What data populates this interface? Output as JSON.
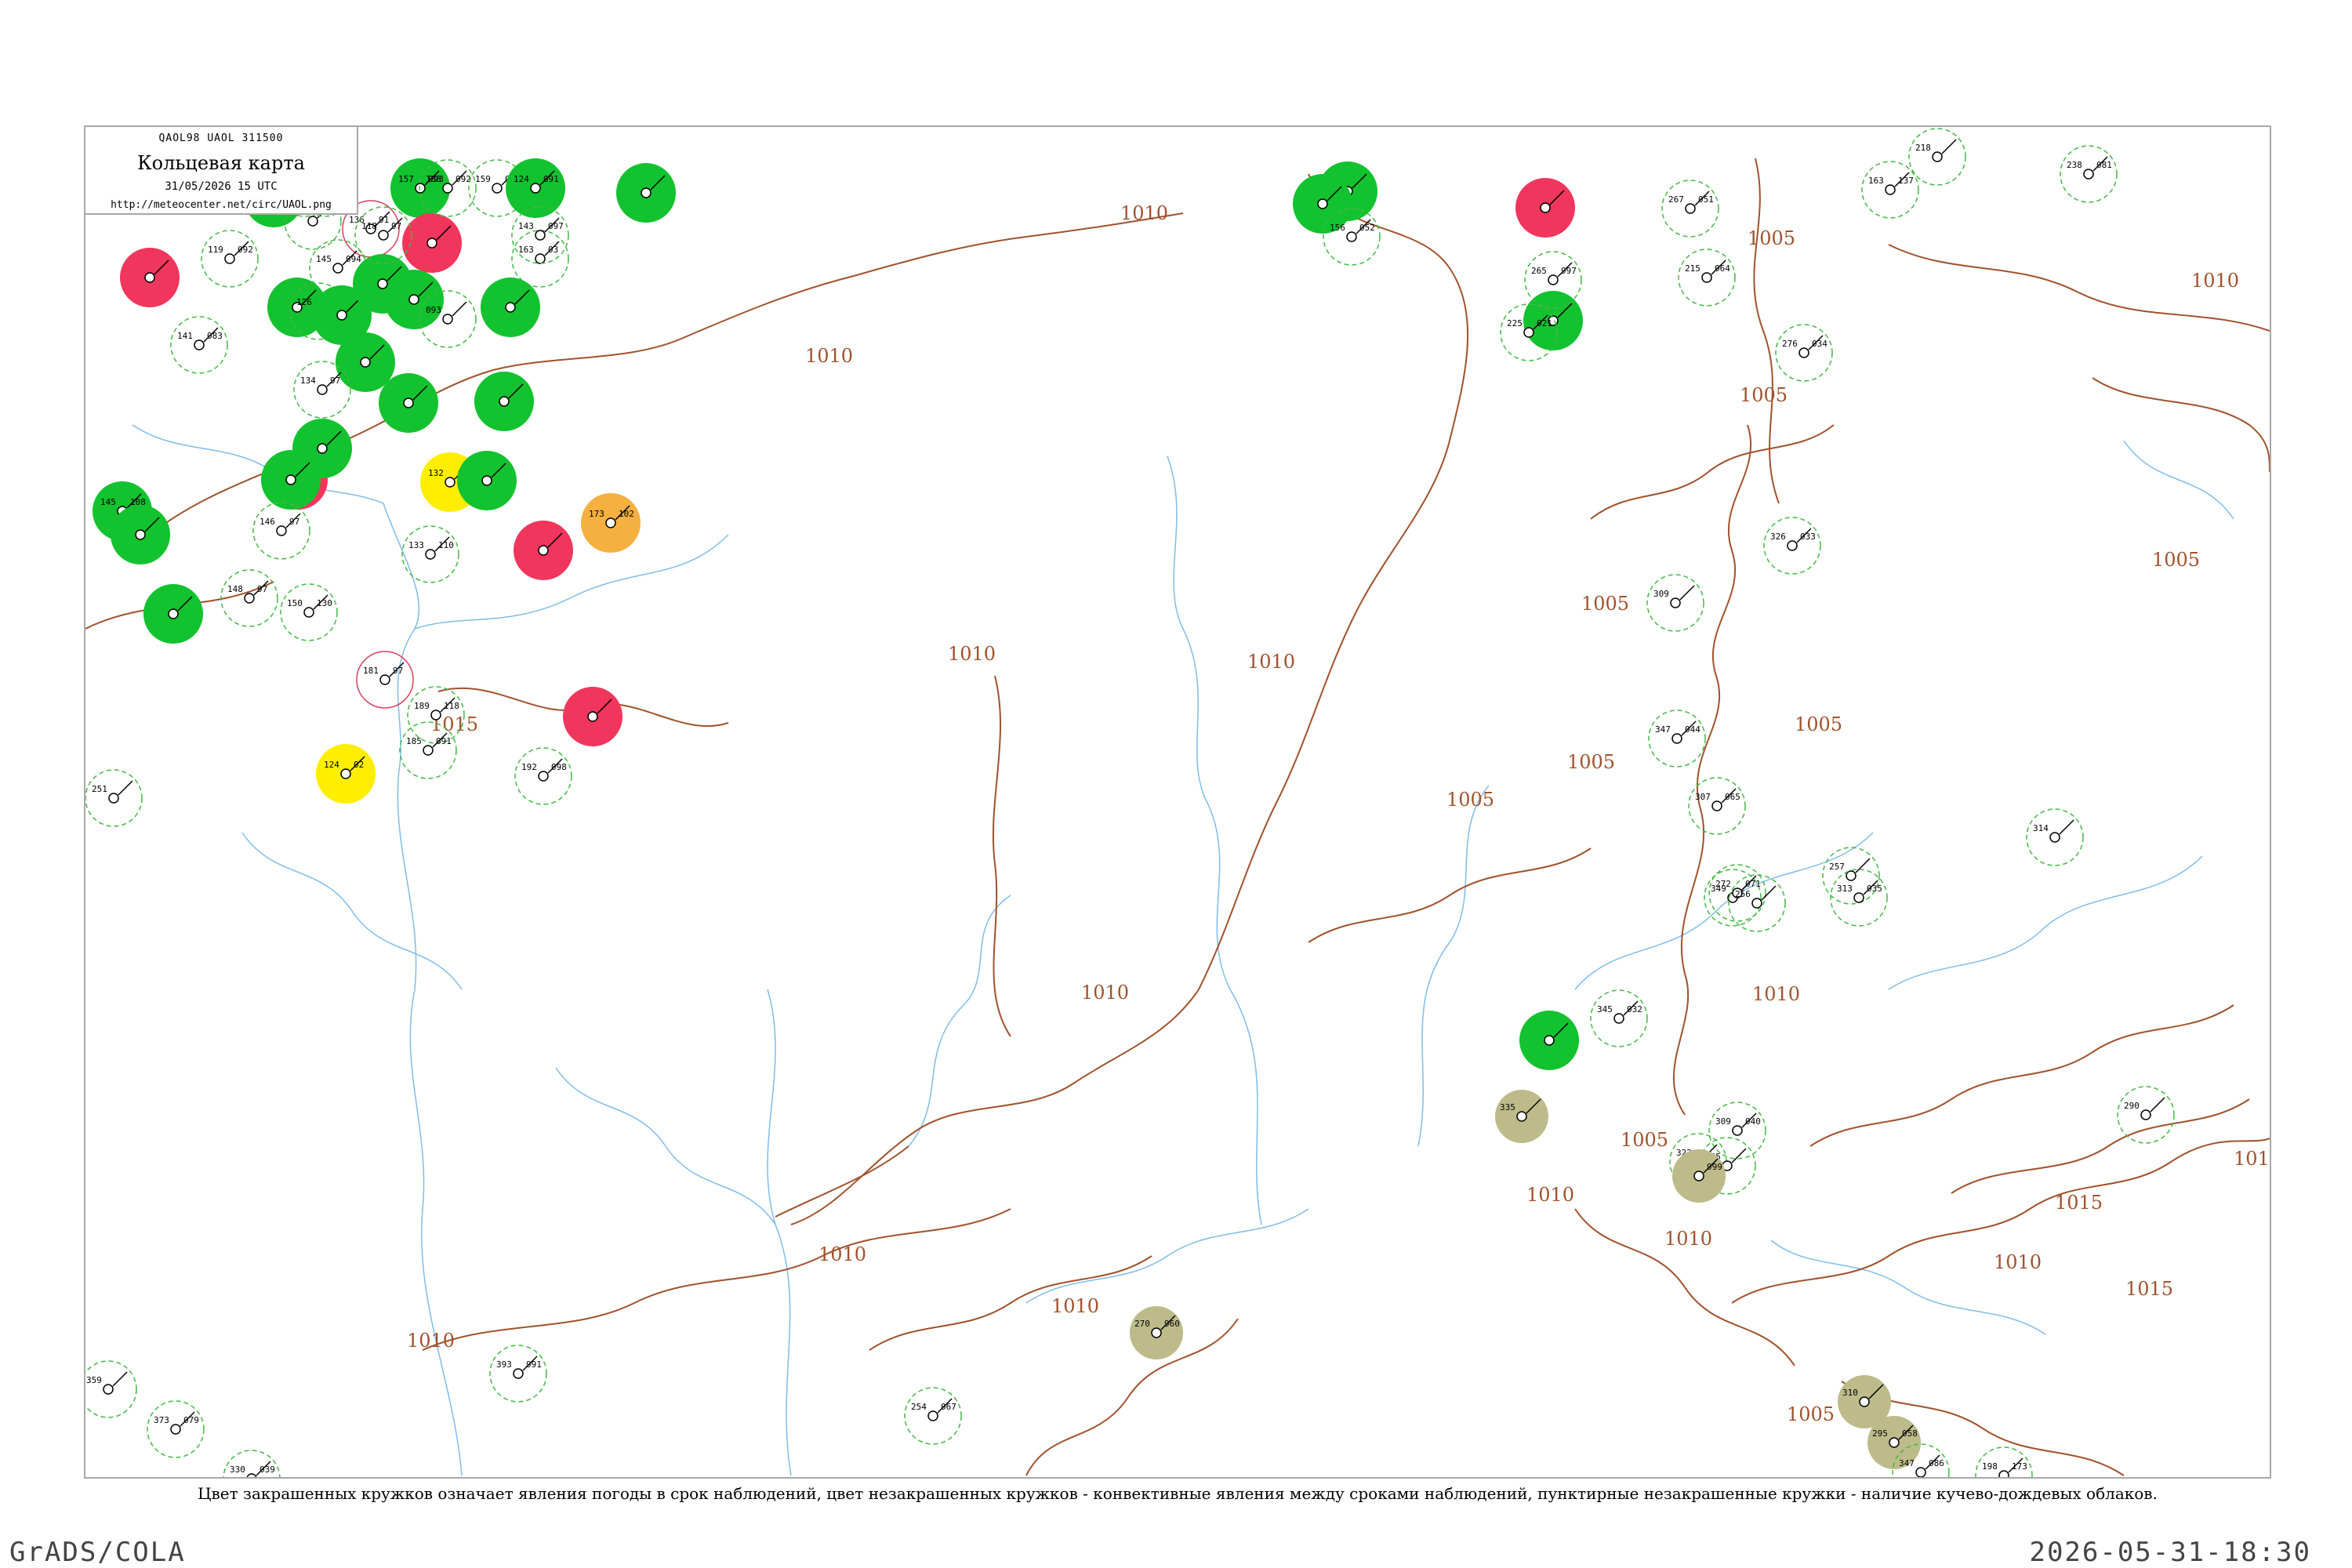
{
  "header": {
    "code": "QAOL98 UAOL 311500",
    "title": "Кольцевая карта",
    "date": "31/05/2026 15 UTC",
    "url": "http://meteocenter.net/circ/UAOL.png"
  },
  "legend_caption": "Цвет закрашенных кружков означает явления погоды в срок наблюдений, цвет незакрашенных кружков - конвективные явления между сроками наблюдений, пунктирные незакрашенные кружки - наличие кучево-дождевых облаков.",
  "footer": {
    "left": "GrADS/COLA",
    "right": "2026-05-31-18:30"
  },
  "colors": {
    "green_fill": "#12c22e",
    "red_fill": "#f0365c",
    "yellow_fill": "#ffee00",
    "orange_fill": "#f5b040",
    "olive_fill": "#bdbb8a",
    "green_ring": "#44b844",
    "red_ring": "#d84060",
    "isobar": "#a0522d",
    "river": "#80bce8"
  },
  "isobar_labels": [
    "1010",
    "1015",
    "1005",
    "101"
  ],
  "stations": [
    {
      "fill": "red",
      "p": "",
      "t": "",
      "n": "",
      "name": ""
    },
    {
      "fill": "green",
      "p": "156",
      "t": "97",
      "n": "",
      "name": ""
    },
    {
      "fill": "none",
      "p": "095",
      "t": "",
      "n": "",
      "name": ""
    },
    {
      "fill": "none",
      "p": "134",
      "t": "97",
      "n": "",
      "name": ""
    },
    {
      "fill": "none",
      "p": "130",
      "t": "97",
      "n": "",
      "name": ""
    },
    {
      "fill": "red-ring",
      "p": "136",
      "t": "91",
      "n": "",
      "name": ""
    },
    {
      "fill": "green",
      "p": "157",
      "t": "093",
      "n": "",
      "name": ""
    },
    {
      "fill": "red",
      "p": "",
      "t": "",
      "n": "",
      "name": ""
    },
    {
      "fill": "none",
      "p": "188",
      "t": "092",
      "n": "",
      "name": ""
    },
    {
      "fill": "none",
      "p": "159",
      "t": "097",
      "n": "",
      "name": ""
    },
    {
      "fill": "green",
      "p": "124",
      "t": "091",
      "n": "",
      "name": ""
    },
    {
      "fill": "green",
      "p": "",
      "t": "",
      "n": "",
      "name": ""
    },
    {
      "fill": "green",
      "p": "",
      "t": "",
      "n": "",
      "name": ""
    },
    {
      "fill": "none",
      "p": "163",
      "t": "03",
      "n": "",
      "name": ""
    },
    {
      "fill": "none",
      "p": "143",
      "t": "097",
      "n": "",
      "name": ""
    },
    {
      "fill": "none",
      "p": "145",
      "t": "094",
      "n": "",
      "name": ""
    },
    {
      "fill": "green",
      "p": "",
      "t": "",
      "n": "",
      "name": ""
    },
    {
      "fill": "green",
      "p": "",
      "t": "",
      "n": "",
      "name": ""
    },
    {
      "fill": "none",
      "p": "119",
      "t": "092",
      "n": "",
      "name": ""
    },
    {
      "fill": "none",
      "p": "126",
      "t": "97",
      "n": "",
      "name": ""
    },
    {
      "fill": "green",
      "p": "",
      "t": "",
      "n": "",
      "name": ""
    },
    {
      "fill": "green",
      "p": "",
      "t": "",
      "n": "",
      "name": ""
    },
    {
      "fill": "none",
      "p": "118",
      "t": "97",
      "n": "",
      "name": ""
    },
    {
      "fill": "green",
      "p": "",
      "t": "",
      "n": "",
      "name": ""
    },
    {
      "fill": "green",
      "p": "",
      "t": "",
      "n": "",
      "name": ""
    },
    {
      "fill": "none",
      "p": "093",
      "t": "",
      "n": "",
      "name": ""
    },
    {
      "fill": "none",
      "p": "141",
      "t": "083",
      "n": "",
      "name": ""
    },
    {
      "fill": "green",
      "p": "",
      "t": "",
      "n": "",
      "name": ""
    },
    {
      "fill": "none",
      "p": "134",
      "t": "97",
      "n": "",
      "name": ""
    },
    {
      "fill": "green",
      "p": "",
      "t": "",
      "n": "",
      "name": ""
    },
    {
      "fill": "red",
      "p": "",
      "t": "",
      "n": "",
      "name": ""
    },
    {
      "fill": "green",
      "p": "",
      "t": "",
      "n": "",
      "name": ""
    },
    {
      "fill": "green",
      "p": "",
      "t": "",
      "n": "",
      "name": ""
    },
    {
      "fill": "yellow",
      "p": "132",
      "t": "96",
      "n": "",
      "name": ""
    },
    {
      "fill": "green",
      "p": "",
      "t": "",
      "n": "",
      "name": ""
    },
    {
      "fill": "orange",
      "p": "173",
      "t": "102",
      "n": "",
      "name": ""
    },
    {
      "fill": "green",
      "p": "145",
      "t": "108",
      "n": "",
      "name": ""
    },
    {
      "fill": "green",
      "p": "",
      "t": "",
      "n": "",
      "name": ""
    },
    {
      "fill": "red",
      "p": "",
      "t": "",
      "n": "",
      "name": ""
    },
    {
      "fill": "none",
      "p": "146",
      "t": "97",
      "n": "",
      "name": ""
    },
    {
      "fill": "none",
      "p": "133",
      "t": "110",
      "n": "",
      "name": ""
    },
    {
      "fill": "green",
      "p": "",
      "t": "",
      "n": "",
      "name": ""
    },
    {
      "fill": "none",
      "p": "148",
      "t": "97",
      "n": "",
      "name": ""
    },
    {
      "fill": "none",
      "p": "150",
      "t": "130",
      "n": "",
      "name": ""
    },
    {
      "fill": "red-ring",
      "p": "181",
      "t": "97",
      "n": "",
      "name": ""
    },
    {
      "fill": "none",
      "p": "189",
      "t": "118",
      "n": "",
      "name": ""
    },
    {
      "fill": "red",
      "p": "",
      "t": "",
      "n": "",
      "name": ""
    },
    {
      "fill": "none",
      "p": "185",
      "t": "091",
      "n": "",
      "name": ""
    },
    {
      "fill": "yellow",
      "p": "124",
      "t": "02",
      "n": "",
      "name": ""
    },
    {
      "fill": "none",
      "p": "192",
      "t": "098",
      "n": "",
      "name": ""
    },
    {
      "fill": "green",
      "p": "",
      "t": "",
      "n": "",
      "name": ""
    },
    {
      "fill": "none",
      "p": "156",
      "t": "052",
      "n": "",
      "name": ""
    },
    {
      "fill": "red",
      "p": "",
      "t": "",
      "n": "",
      "name": ""
    },
    {
      "fill": "green",
      "p": "",
      "t": "",
      "n": "",
      "name": ""
    },
    {
      "fill": "none",
      "p": "265",
      "t": "997",
      "n": "",
      "name": ""
    },
    {
      "fill": "none",
      "p": "225",
      "t": "021",
      "n": "",
      "name": ""
    },
    {
      "fill": "none",
      "p": "267",
      "t": "051",
      "n": "",
      "name": ""
    },
    {
      "fill": "none",
      "p": "215",
      "t": "064",
      "n": "",
      "name": ""
    },
    {
      "fill": "none",
      "p": "276",
      "t": "034",
      "n": "",
      "name": ""
    },
    {
      "fill": "none",
      "p": "326",
      "t": "033",
      "n": "",
      "name": ""
    },
    {
      "fill": "none",
      "p": "309",
      "t": "",
      "n": "",
      "name": ""
    },
    {
      "fill": "none",
      "p": "347",
      "t": "044",
      "n": "",
      "name": ""
    },
    {
      "fill": "none",
      "p": "307",
      "t": "065",
      "n": "",
      "name": ""
    },
    {
      "fill": "none",
      "p": "349",
      "t": "",
      "n": "",
      "name": ""
    },
    {
      "fill": "none",
      "p": "272",
      "t": "071",
      "n": "",
      "name": ""
    },
    {
      "fill": "none",
      "p": "256",
      "t": "",
      "n": "",
      "name": ""
    },
    {
      "fill": "none",
      "p": "257",
      "t": "",
      "n": "",
      "name": ""
    },
    {
      "fill": "none",
      "p": "313",
      "t": "035",
      "n": "",
      "name": ""
    },
    {
      "fill": "none",
      "p": "314",
      "t": "",
      "n": "",
      "name": ""
    },
    {
      "fill": "none",
      "p": "345",
      "t": "032",
      "n": "",
      "name": ""
    },
    {
      "fill": "green",
      "p": "",
      "t": "",
      "n": "",
      "name": ""
    },
    {
      "fill": "none",
      "p": "309",
      "t": "040",
      "n": "",
      "name": ""
    },
    {
      "fill": "none",
      "p": "322",
      "t": "",
      "n": "",
      "name": ""
    },
    {
      "fill": "none",
      "p": "205",
      "t": "",
      "n": "",
      "name": ""
    },
    {
      "fill": "olive",
      "p": "335",
      "t": "",
      "n": "",
      "name": ""
    },
    {
      "fill": "olive",
      "p": "",
      "t": "999",
      "n": "",
      "name": ""
    },
    {
      "fill": "olive",
      "p": "270",
      "t": "960",
      "n": "",
      "name": ""
    },
    {
      "fill": "olive",
      "p": "310",
      "t": "",
      "n": "",
      "name": ""
    },
    {
      "fill": "olive",
      "p": "295",
      "t": "058",
      "n": "",
      "name": ""
    },
    {
      "fill": "none",
      "p": "347",
      "t": "086",
      "n": "",
      "name": ""
    },
    {
      "fill": "none",
      "p": "359",
      "t": "",
      "n": "",
      "name": ""
    },
    {
      "fill": "none",
      "p": "373",
      "t": "079",
      "n": "",
      "name": ""
    },
    {
      "fill": "none",
      "p": "330",
      "t": "039",
      "n": "",
      "name": ""
    },
    {
      "fill": "none",
      "p": "393",
      "t": "991",
      "n": "",
      "name": ""
    },
    {
      "fill": "none",
      "p": "254",
      "t": "067",
      "n": "",
      "name": ""
    },
    {
      "fill": "none",
      "p": "218",
      "t": "",
      "n": "",
      "name": ""
    },
    {
      "fill": "none",
      "p": "163",
      "t": "137",
      "n": "",
      "name": ""
    },
    {
      "fill": "none",
      "p": "238",
      "t": "081",
      "n": "",
      "name": ""
    },
    {
      "fill": "none",
      "p": "290",
      "t": "",
      "n": "",
      "name": ""
    },
    {
      "fill": "none",
      "p": "198",
      "t": "173",
      "n": "",
      "name": ""
    },
    {
      "fill": "none",
      "p": "251",
      "t": "",
      "n": "",
      "name": ""
    }
  ]
}
